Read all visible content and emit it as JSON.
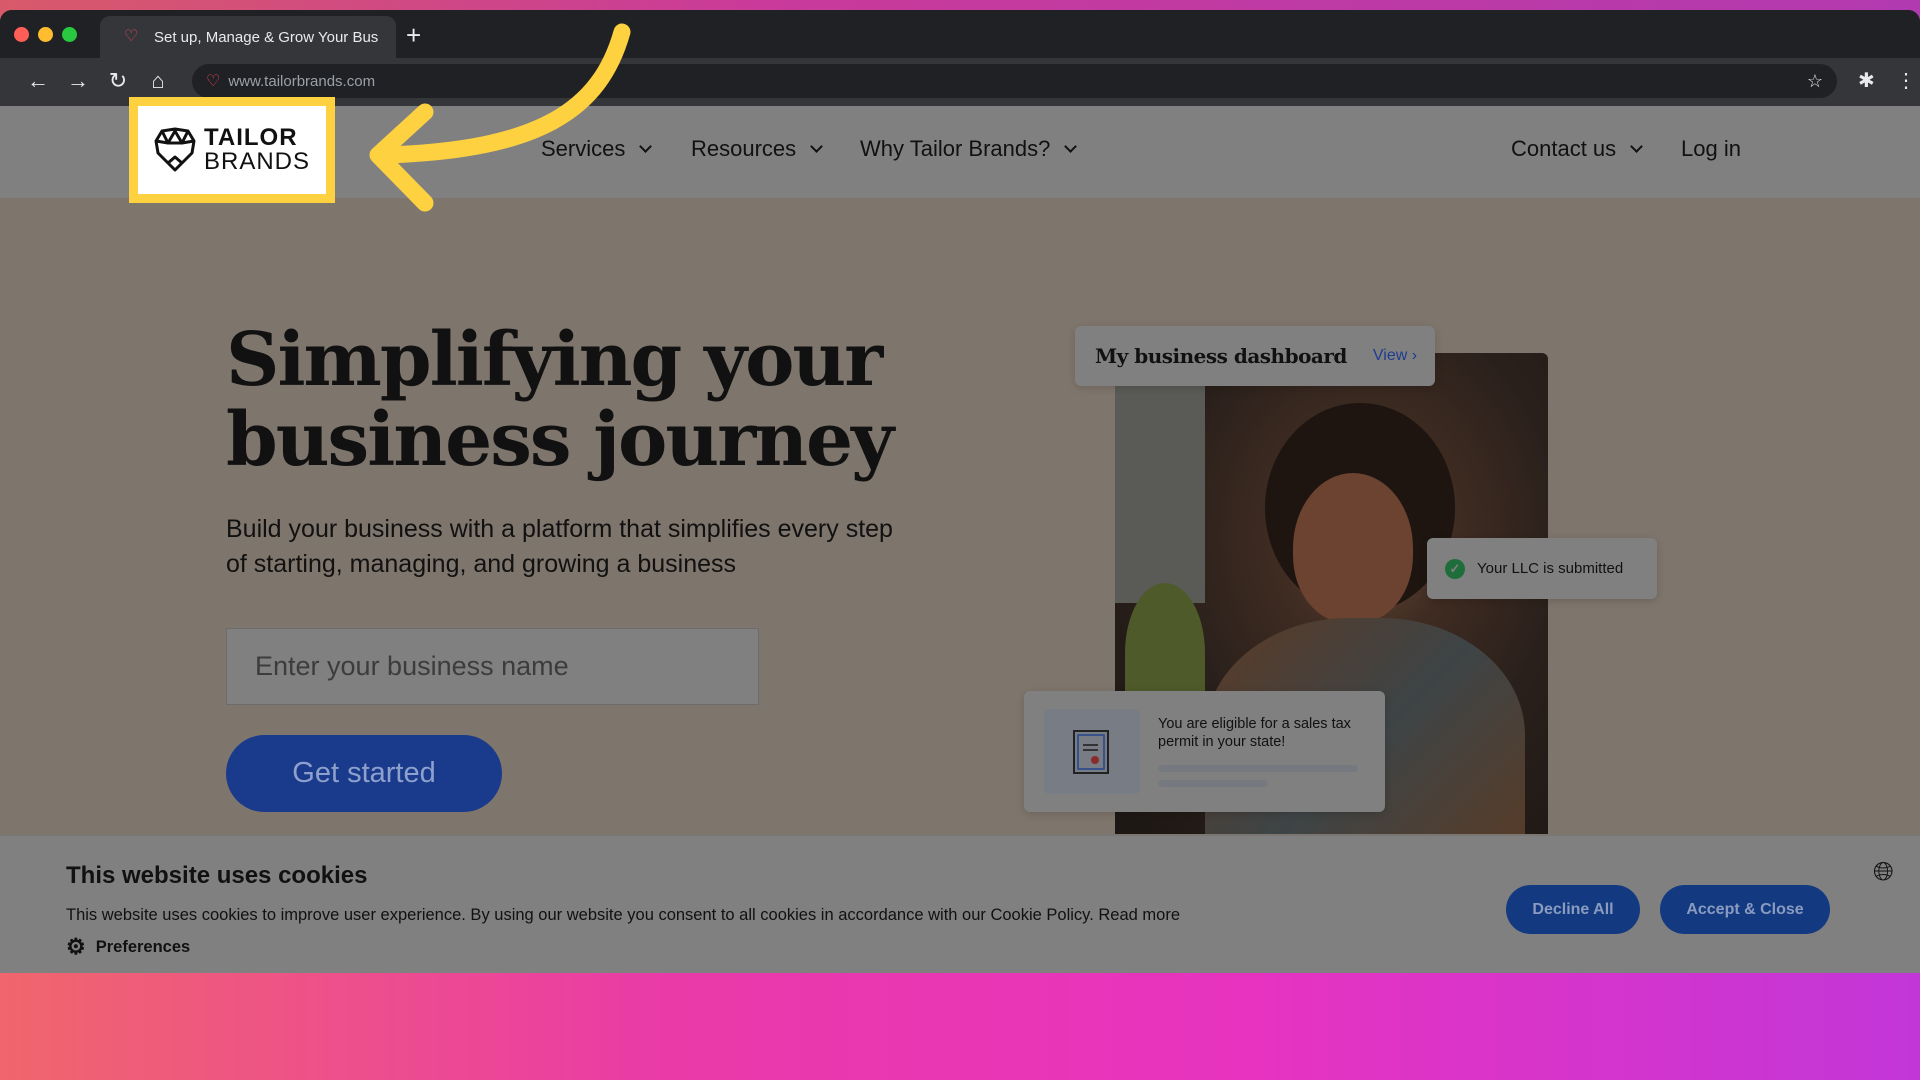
{
  "browser": {
    "tab_title": "Set up, Manage & Grow Your Bus",
    "url": "www.tailorbrands.com",
    "new_tab_label": "+"
  },
  "nav": {
    "logo": {
      "line1": "TAILOR",
      "line2": "BRANDS"
    },
    "items": [
      {
        "label": "Services"
      },
      {
        "label": "Resources"
      },
      {
        "label": "Why Tailor Brands?"
      },
      {
        "label": "Contact us"
      }
    ],
    "login": "Log in"
  },
  "hero": {
    "title_line1": "Simplifying your",
    "title_line2": "business journey",
    "subtitle": "Build your business with a platform that simplifies every step of starting, managing, and growing a business",
    "input_placeholder": "Enter your business name",
    "cta": "Get started"
  },
  "dashboard": {
    "title": "My business dashboard",
    "view": "View ›",
    "llc_status": "Your LLC is submitted",
    "permit_text": "You are eligible for a sales tax permit in your state!"
  },
  "cookie": {
    "title": "This website uses cookies",
    "text": "This website uses cookies to improve user experience. By using our website you consent to all cookies in accordance with our Cookie Policy. Read more",
    "preferences": "Preferences",
    "decline": "Decline All",
    "accept": "Accept & Close"
  },
  "colors": {
    "highlight": "#fdd13f",
    "button_blue": "#1a3a8c",
    "success": "#1e6d3a"
  }
}
